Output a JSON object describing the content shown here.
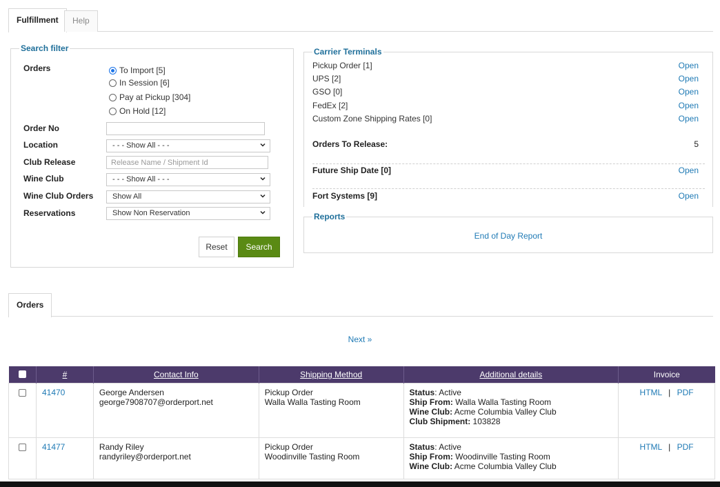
{
  "tabs": {
    "fulfillment": "Fulfillment",
    "help": "Help"
  },
  "search_filter": {
    "legend": "Search filter",
    "orders_label": "Orders",
    "radios": [
      "To Import [5]",
      "In Session [6]",
      "Pay at Pickup [304]",
      "On Hold [12]"
    ],
    "order_no_label": "Order No",
    "order_no_value": "",
    "location_label": "Location",
    "location_value": "- - - Show All - - -",
    "club_release_label": "Club Release",
    "club_release_placeholder": "Release Name / Shipment Id",
    "wine_club_label": "Wine Club",
    "wine_club_value": "- - - Show All - - -",
    "wine_club_orders_label": "Wine Club Orders",
    "wine_club_orders_value": "Show All",
    "reservations_label": "Reservations",
    "reservations_value": "Show Non Reservation",
    "reset": "Reset",
    "search": "Search"
  },
  "carrier": {
    "legend": "Carrier Terminals",
    "rows": [
      {
        "label": "Pickup Order [1]",
        "action": "Open"
      },
      {
        "label": "UPS [2]",
        "action": "Open"
      },
      {
        "label": "GSO [0]",
        "action": "Open"
      },
      {
        "label": "FedEx [2]",
        "action": "Open"
      },
      {
        "label": "Custom Zone Shipping Rates [0]",
        "action": "Open"
      }
    ],
    "orders_to_release_label": "Orders To Release:",
    "orders_to_release_value": "5",
    "future_ship_label": "Future Ship Date [0]",
    "future_ship_action": "Open",
    "fort_label": "Fort Systems [9]",
    "fort_action": "Open"
  },
  "reports": {
    "legend": "Reports",
    "end_of_day": "End of Day Report"
  },
  "orders_tab": "Orders",
  "pager_next": "Next »",
  "table": {
    "headers": [
      "#",
      "Contact Info",
      "Shipping Method",
      "Additional details",
      "Invoice"
    ],
    "rows": [
      {
        "id": "41470",
        "name": "George Andersen",
        "email": "george7908707@orderport.net",
        "ship_method": "Pickup Order",
        "ship_location": "Walla Walla Tasting Room",
        "status_label": "Status",
        "status": ": Active",
        "ship_from_label": "Ship From:",
        "ship_from": " Walla Walla Tasting Room",
        "wine_club_label": "Wine Club:",
        "wine_club": " Acme Columbia Valley Club",
        "club_shipment_label": "Club Shipment:",
        "club_shipment": " 103828",
        "html": "HTML",
        "sep": "|",
        "pdf": "PDF"
      },
      {
        "id": "41477",
        "name": "Randy Riley",
        "email": "randyriley@orderport.net",
        "ship_method": "Pickup Order",
        "ship_location": "Woodinville Tasting Room",
        "status_label": "Status",
        "status": ": Active",
        "ship_from_label": "Ship From:",
        "ship_from": " Woodinville Tasting Room",
        "wine_club_label": "Wine Club:",
        "wine_club": " Acme Columbia Valley Club",
        "html": "HTML",
        "sep": "|",
        "pdf": "PDF"
      }
    ]
  }
}
